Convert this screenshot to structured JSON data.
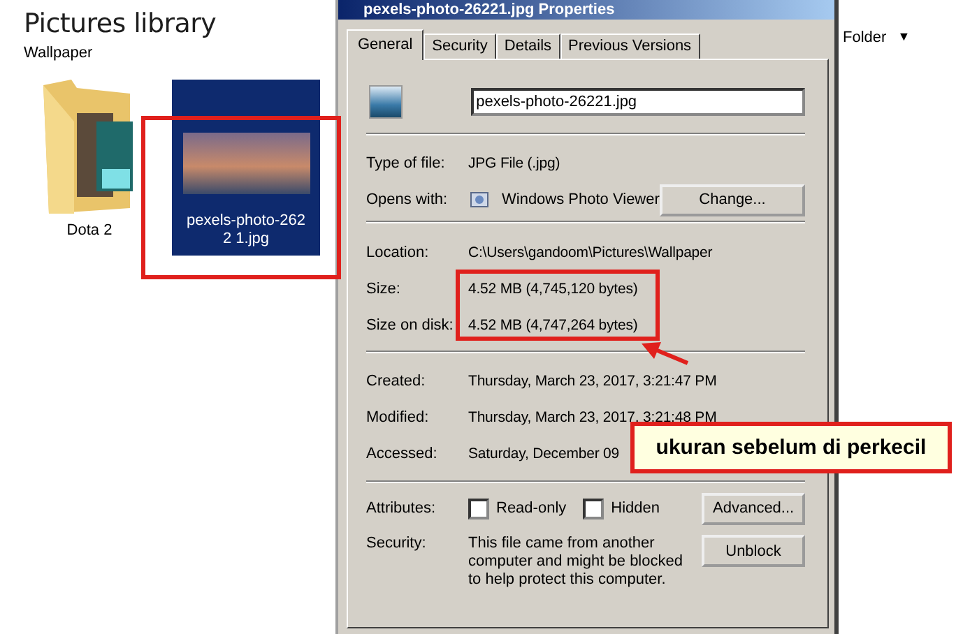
{
  "explorer": {
    "title": "Pictures library",
    "breadcrumb": "Wallpaper",
    "items": [
      {
        "name": "Dota 2",
        "kind": "folder",
        "selected": false
      },
      {
        "name": "pexels-photo-2622 1.jpg",
        "kind": "image",
        "selected": true
      }
    ]
  },
  "view_menu": {
    "label": "Folder",
    "caret": "▼"
  },
  "dialog": {
    "title": "pexels-photo-26221.jpg Properties",
    "tabs": [
      {
        "label": "General",
        "selected": true
      },
      {
        "label": "Security",
        "selected": false
      },
      {
        "label": "Details",
        "selected": false
      },
      {
        "label": "Previous Versions",
        "selected": false
      }
    ],
    "filename": "pexels-photo-26221.jpg",
    "type": {
      "label": "Type of file:",
      "value": "JPG File (.jpg)"
    },
    "opens_with": {
      "label": "Opens with:",
      "value": "Windows Photo Viewer",
      "button": "Change..."
    },
    "location_group": [
      {
        "label": "Location:",
        "value": "C:\\Users\\gandoom\\Pictures\\Wallpaper"
      },
      {
        "label": "Size:",
        "value": "4.52 MB (4,745,120 bytes)"
      },
      {
        "label": "Size on disk:",
        "value": "4.52 MB (4,747,264 bytes)"
      }
    ],
    "dates_group": [
      {
        "label": "Created:",
        "value": "Thursday, March 23, 2017, 3:21:47 PM"
      },
      {
        "label": "Modified:",
        "value": "Thursday, March 23, 2017, 3:21:48 PM"
      },
      {
        "label": "Accessed:",
        "value": "Saturday, December 09"
      }
    ],
    "attributes": {
      "label": "Attributes:",
      "checkboxes": [
        {
          "label": "Read-only",
          "checked": false
        },
        {
          "label": "Hidden",
          "checked": false
        }
      ],
      "button": "Advanced..."
    },
    "security": {
      "label": "Security:",
      "text": "This file came from another computer and might be blocked to help protect this computer.",
      "button": "Unblock"
    }
  },
  "annotation": {
    "callout": "ukuran sebelum di perkecil"
  }
}
